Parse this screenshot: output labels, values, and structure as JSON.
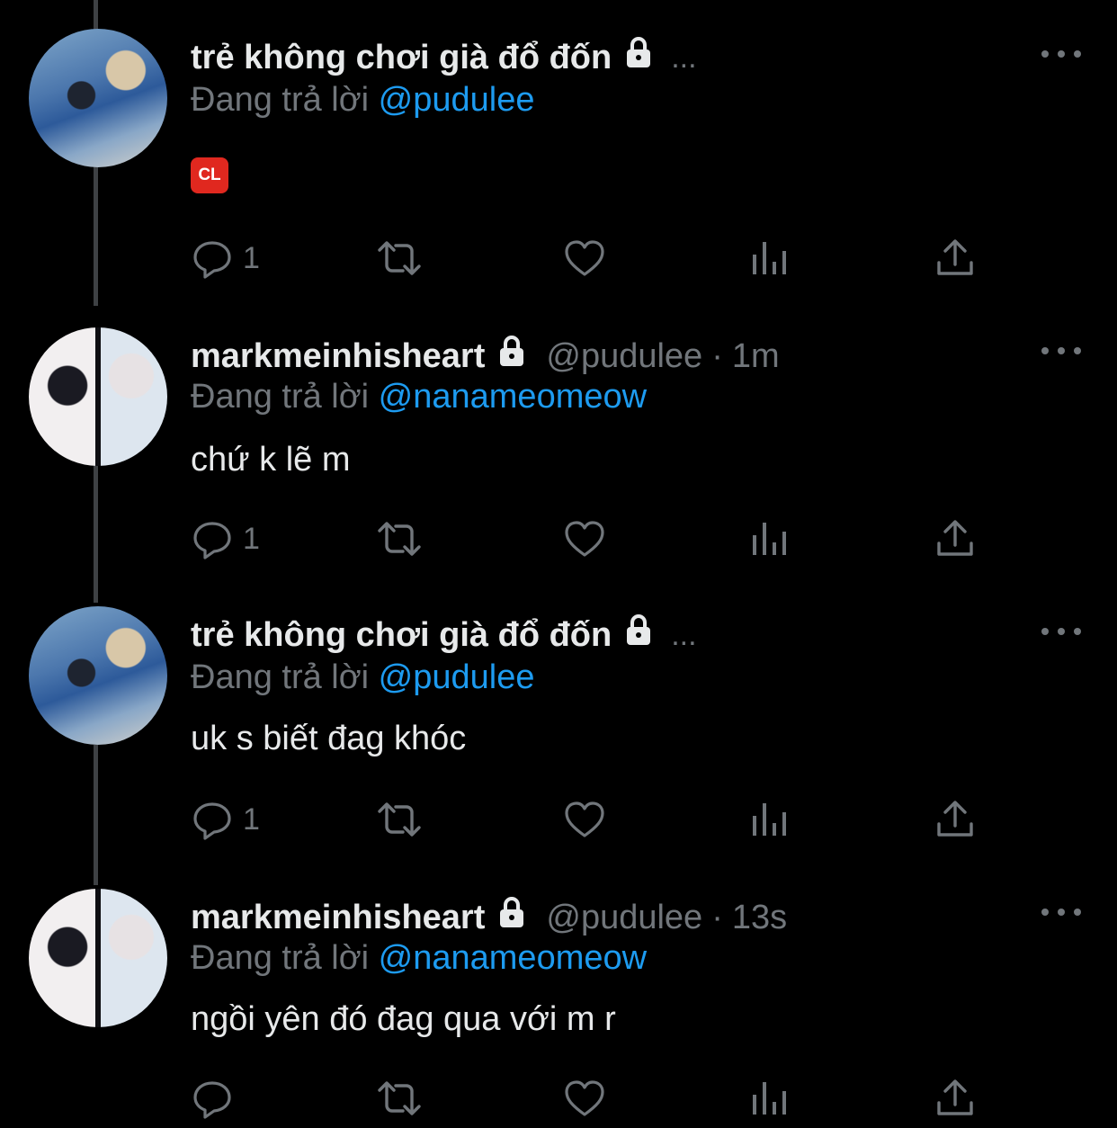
{
  "tweets": [
    {
      "display_name": "trẻ không chơi già đổ đốn",
      "name_overflow": "...",
      "handle": "",
      "dot": "",
      "time": "",
      "reply_prefix": "Đang trả lời",
      "reply_to": "@pudulee",
      "text": "",
      "emoji_badge": "CL",
      "reply_count": "1",
      "avatar": "avatar-couple-boat"
    },
    {
      "display_name": "markmeinhisheart",
      "name_overflow": "",
      "handle": "@pudulee",
      "dot": "·",
      "time": "1m",
      "reply_prefix": "Đang trả lời",
      "reply_to": "@nanameomeow",
      "text": "chứ k lẽ m",
      "emoji_badge": "",
      "reply_count": "1",
      "avatar": "avatar-photo-cards"
    },
    {
      "display_name": "trẻ không chơi già đổ đốn",
      "name_overflow": "...",
      "handle": "",
      "dot": "",
      "time": "",
      "reply_prefix": "Đang trả lời",
      "reply_to": "@pudulee",
      "text": "uk s biết đag khóc",
      "emoji_badge": "",
      "reply_count": "1",
      "avatar": "avatar-couple-boat"
    },
    {
      "display_name": "markmeinhisheart",
      "name_overflow": "",
      "handle": "@pudulee",
      "dot": "·",
      "time": "13s",
      "reply_prefix": "Đang trả lời",
      "reply_to": "@nanameomeow",
      "text": "ngồi yên đó đag qua với m r",
      "emoji_badge": "",
      "reply_count": "",
      "avatar": "avatar-photo-cards"
    }
  ],
  "icons": {
    "reply": "reply-icon",
    "retweet": "retweet-icon",
    "like": "heart-icon",
    "views": "analytics-icon",
    "share": "share-icon",
    "more": "more-icon",
    "lock": "lock-icon"
  },
  "colors": {
    "background": "#000000",
    "text": "#e7e9ea",
    "secondary": "#71767b",
    "link": "#1d9bf0",
    "thread_line": "#3e4144",
    "cl_badge": "#e0281f"
  }
}
